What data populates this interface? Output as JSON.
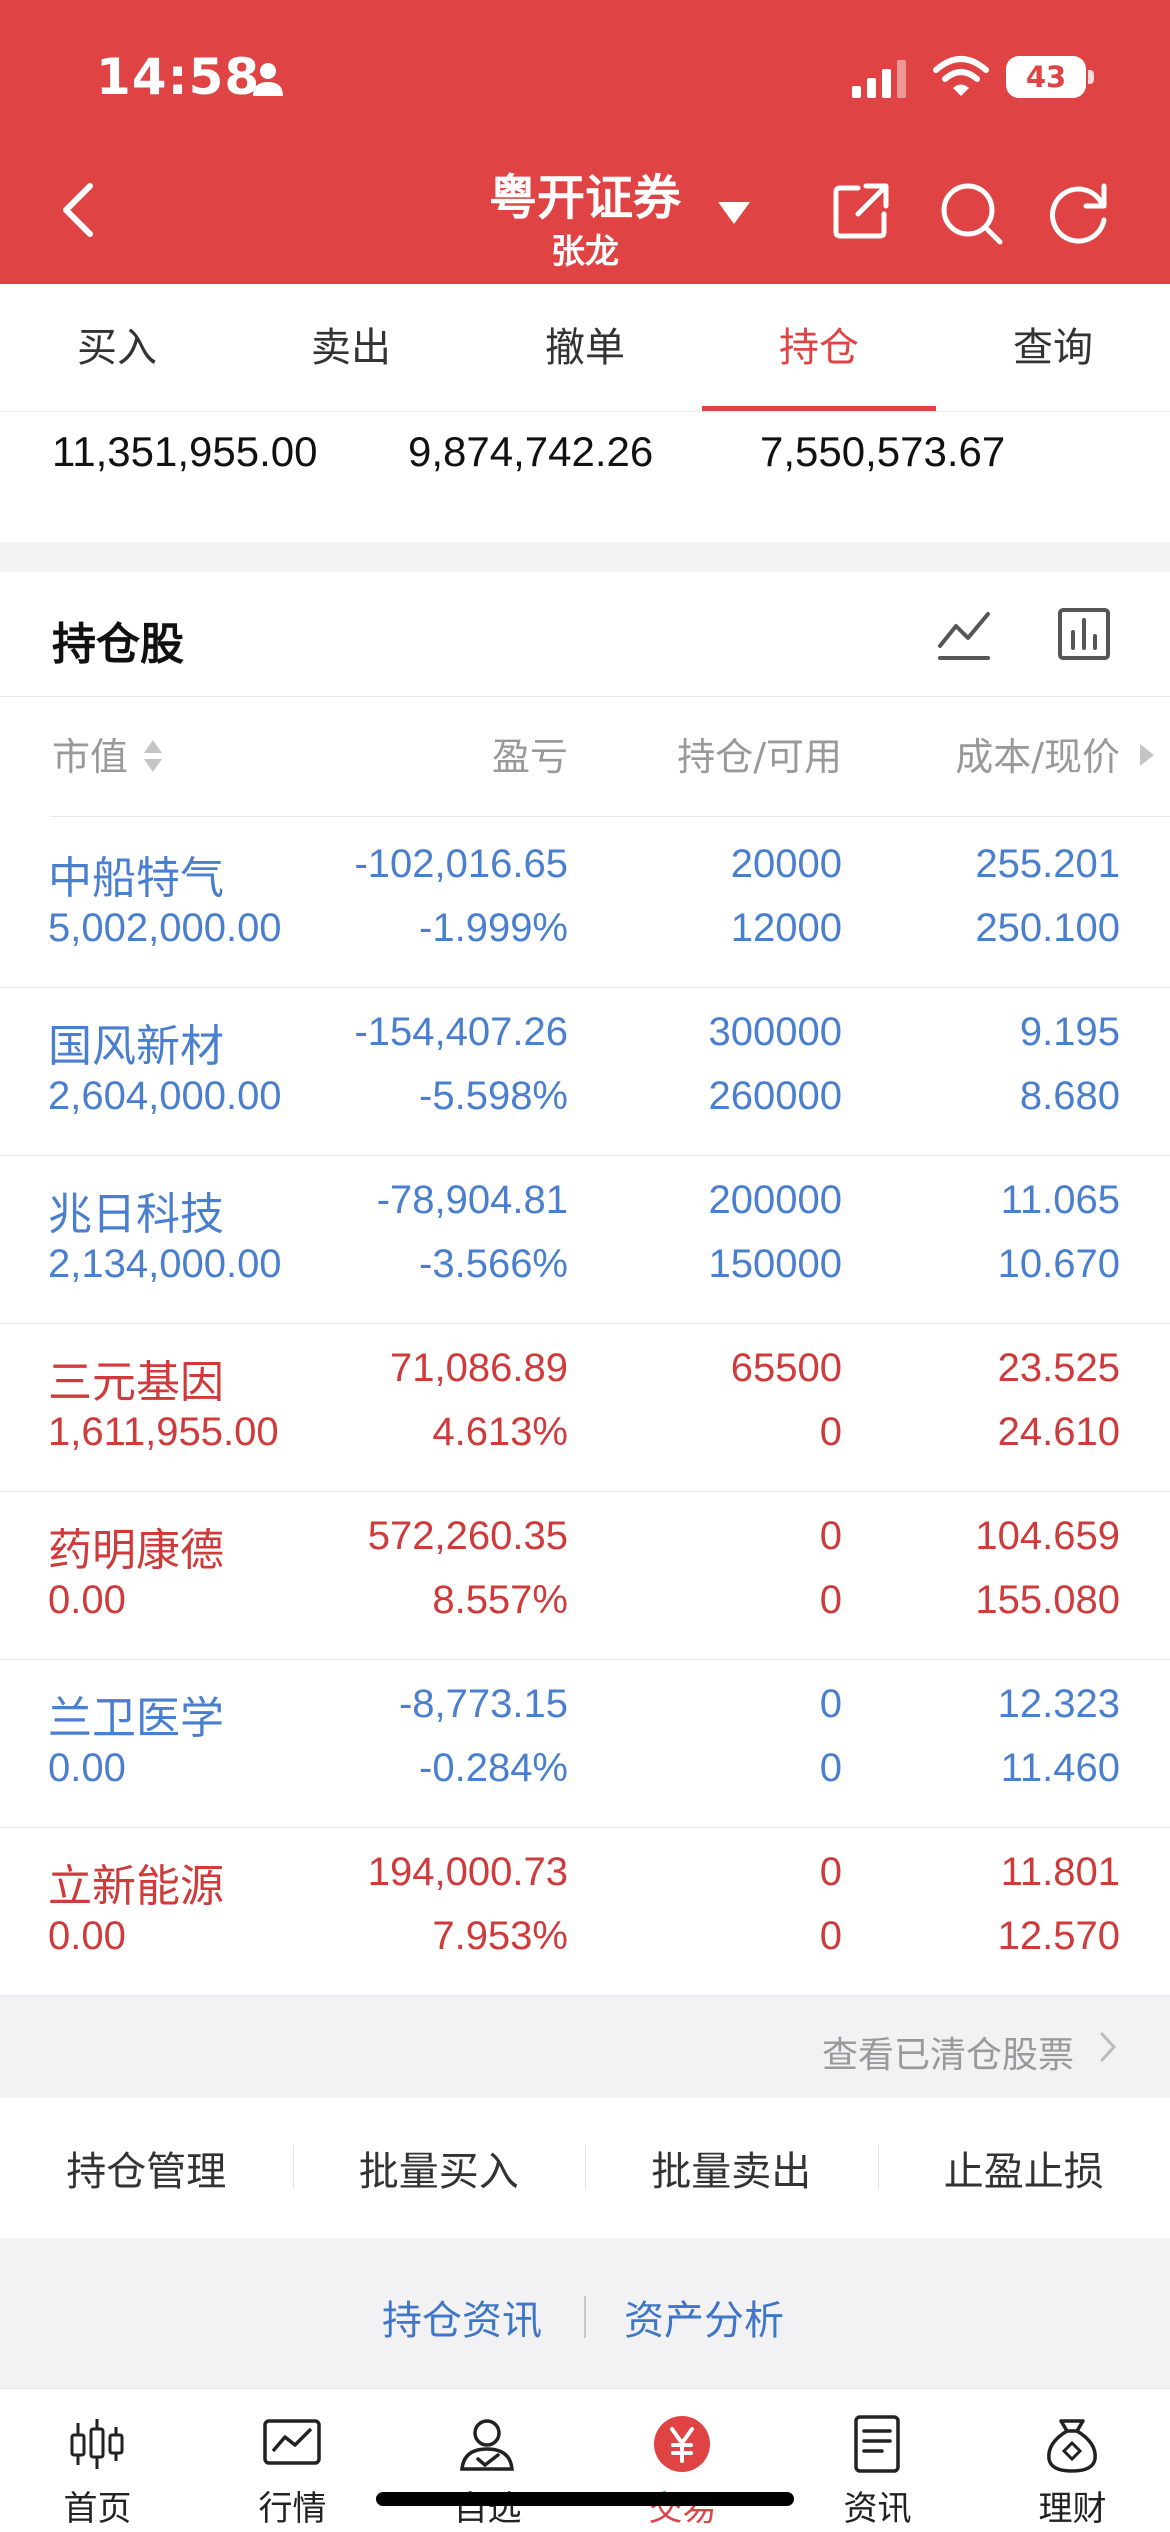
{
  "status": {
    "time": "14:58",
    "battery": "43"
  },
  "header": {
    "broker": "粤开证券",
    "account": "张龙"
  },
  "tabs": [
    "买入",
    "卖出",
    "撤单",
    "持仓",
    "查询"
  ],
  "active_tab": "持仓",
  "assets": [
    "11,351,955.00",
    "9,874,742.26",
    "7,550,573.67"
  ],
  "holdings": {
    "title": "持仓股",
    "columns": {
      "market_value": "市值",
      "profit_loss": "盈亏",
      "position": "持仓/可用",
      "cost_price": "成本/现价"
    },
    "rows": [
      {
        "name": "中船特气",
        "market_value": "5,002,000.00",
        "pl": "-102,016.65",
        "pl_ratio": "-1.999%",
        "hold": "20000",
        "avail": "12000",
        "cost": "255.201",
        "price": "250.100",
        "color": "blue"
      },
      {
        "name": "国风新材",
        "market_value": "2,604,000.00",
        "pl": "-154,407.26",
        "pl_ratio": "-5.598%",
        "hold": "300000",
        "avail": "260000",
        "cost": "9.195",
        "price": "8.680",
        "color": "blue"
      },
      {
        "name": "兆日科技",
        "market_value": "2,134,000.00",
        "pl": "-78,904.81",
        "pl_ratio": "-3.566%",
        "hold": "200000",
        "avail": "150000",
        "cost": "11.065",
        "price": "10.670",
        "color": "blue"
      },
      {
        "name": "三元基因",
        "market_value": "1,611,955.00",
        "pl": "71,086.89",
        "pl_ratio": "4.613%",
        "hold": "65500",
        "avail": "0",
        "cost": "23.525",
        "price": "24.610",
        "color": "red"
      },
      {
        "name": "药明康德",
        "market_value": "0.00",
        "pl": "572,260.35",
        "pl_ratio": "8.557%",
        "hold": "0",
        "avail": "0",
        "cost": "104.659",
        "price": "155.080",
        "color": "red"
      },
      {
        "name": "兰卫医学",
        "market_value": "0.00",
        "pl": "-8,773.15",
        "pl_ratio": "-0.284%",
        "hold": "0",
        "avail": "0",
        "cost": "12.323",
        "price": "11.460",
        "color": "blue"
      },
      {
        "name": "立新能源",
        "market_value": "0.00",
        "pl": "194,000.73",
        "pl_ratio": "7.953%",
        "hold": "0",
        "avail": "0",
        "cost": "11.801",
        "price": "12.570",
        "color": "red"
      }
    ]
  },
  "cleared_link": "查看已清仓股票",
  "actions": [
    "持仓管理",
    "批量买入",
    "批量卖出",
    "止盈止损"
  ],
  "links": [
    "持仓资讯",
    "资产分析"
  ],
  "nav": [
    {
      "label": "首页",
      "icon": "candlestick-icon"
    },
    {
      "label": "行情",
      "icon": "chart-icon"
    },
    {
      "label": "自选",
      "icon": "person-check-icon"
    },
    {
      "label": "交易",
      "icon": "yen-icon"
    },
    {
      "label": "资讯",
      "icon": "document-icon"
    },
    {
      "label": "理财",
      "icon": "money-bag-icon"
    }
  ],
  "colors": {
    "brand": "#e04343",
    "loss": "#4a7fd0",
    "gain": "#cf3a3a"
  }
}
